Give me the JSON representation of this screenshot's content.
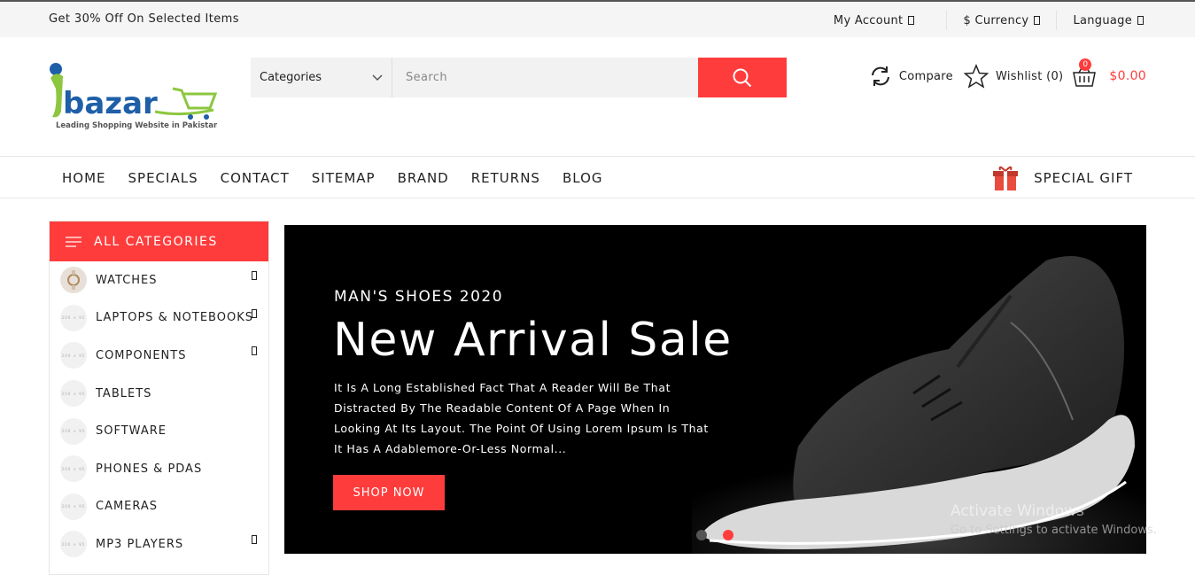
{
  "topbar": {
    "promo": "Get 30% Off On Selected Items",
    "account": "My Account",
    "currency": "$ Currency",
    "language": "Language"
  },
  "logo": {
    "name": "ibazar",
    "tagline": "Leading Shopping Website in Pakistan"
  },
  "search": {
    "category": "Categories",
    "placeholder": "Search"
  },
  "actions": {
    "compare": "Compare",
    "wishlist": "Wishlist (0)",
    "cart_count": "0",
    "cart_total": "$0.00"
  },
  "nav": {
    "items": [
      "HOME",
      "SPECIALS",
      "CONTACT",
      "SITEMAP",
      "BRAND",
      "RETURNS",
      "BLOG"
    ],
    "gift": "SPECIAL GIFT"
  },
  "sidebar": {
    "title": "ALL CATEGORIES",
    "items": [
      {
        "label": "WATCHES",
        "thumb": "",
        "arrow": true
      },
      {
        "label": "LAPTOPS & NOTEBOOKS",
        "thumb": "200 × 95",
        "arrow": true
      },
      {
        "label": "COMPONENTS",
        "thumb": "200 × 95",
        "arrow": true
      },
      {
        "label": "TABLETS",
        "thumb": "200 × 95",
        "arrow": false
      },
      {
        "label": "SOFTWARE",
        "thumb": "200 × 95",
        "arrow": false
      },
      {
        "label": "PHONES & PDAS",
        "thumb": "200 × 95",
        "arrow": false
      },
      {
        "label": "CAMERAS",
        "thumb": "200 × 95",
        "arrow": false
      },
      {
        "label": "MP3 PLAYERS",
        "thumb": "200 × 95",
        "arrow": true
      }
    ]
  },
  "banner": {
    "subtitle": "MAN'S SHOES 2020",
    "title": "New Arrival Sale",
    "text": "It Is A Long Established Fact That A Reader Will Be That Distracted By The Readable Content Of A Page When In Looking At Its Layout. The Point Of Using Lorem Ipsum Is That It Has A Adablemore-Or-Less Normal...",
    "button": "SHOP NOW"
  },
  "watermark": {
    "line1": "Activate Windows",
    "line2": "Go to Settings to activate Windows."
  },
  "colors": {
    "accent": "#ff3c3c",
    "brand_blue": "#1e5fa8",
    "brand_green": "#8dc63f"
  }
}
